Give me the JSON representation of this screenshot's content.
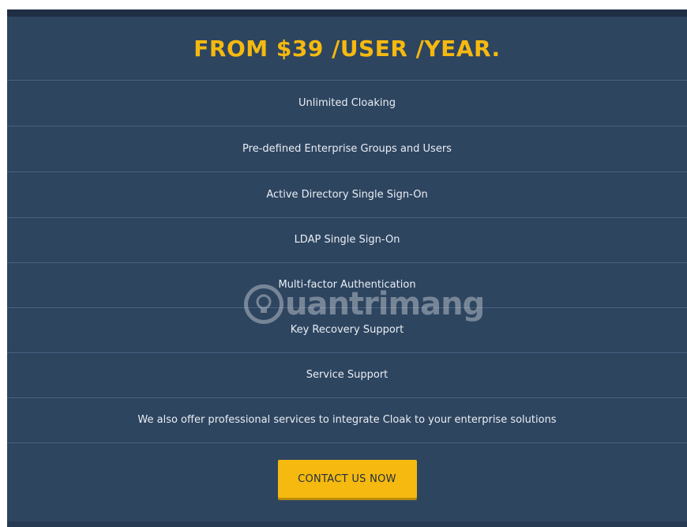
{
  "pricing": {
    "title": "FROM $39 /USER /YEAR.",
    "features": [
      "Unlimited Cloaking",
      "Pre-defined Enterprise Groups and Users",
      "Active Directory Single Sign-On",
      "LDAP Single Sign-On",
      "Multi-factor Authentication",
      "Key Recovery Support",
      "Service Support",
      "We also offer professional services to integrate Cloak to your enterprise solutions"
    ],
    "cta_label": "CONTACT US NOW"
  },
  "watermark": {
    "text": "uantrimang",
    "icon": "lightbulb-icon"
  },
  "colors": {
    "panel": "#2e4560",
    "accent": "#f5b90f",
    "text": "#e9eef4"
  }
}
